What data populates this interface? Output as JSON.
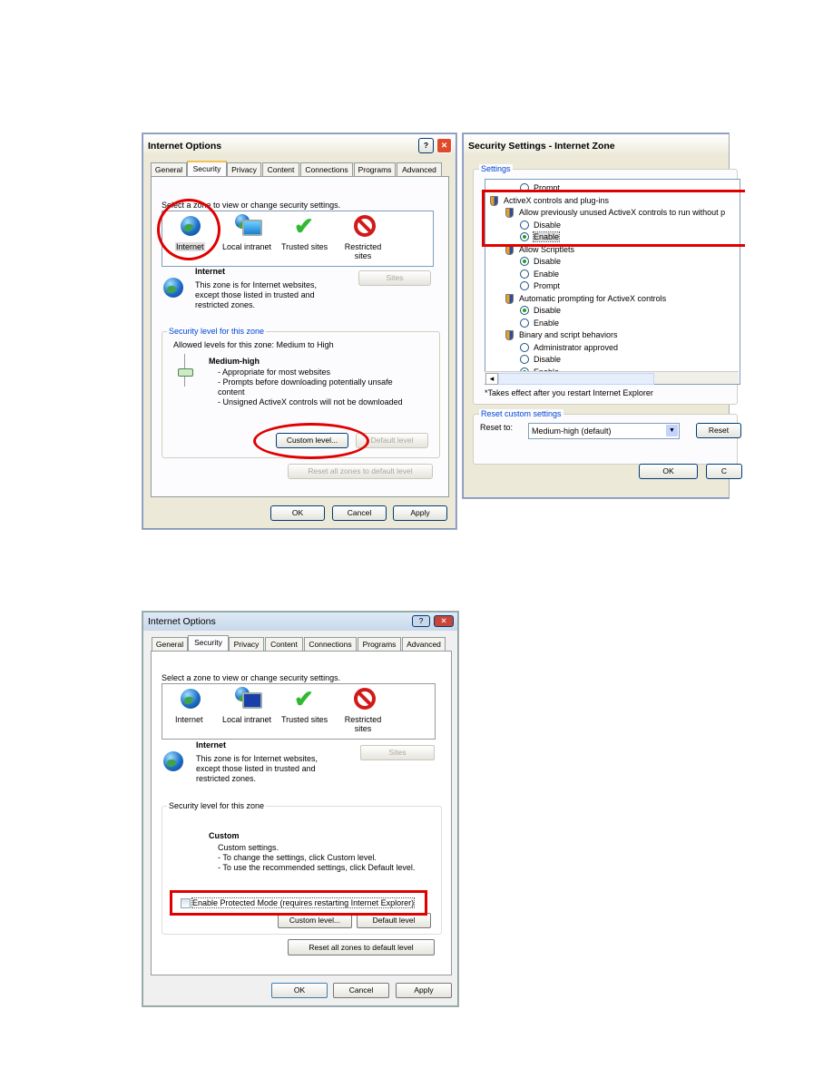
{
  "dialog1": {
    "title": "Internet Options",
    "tabs": [
      "General",
      "Security",
      "Privacy",
      "Content",
      "Connections",
      "Programs",
      "Advanced"
    ],
    "zone_prompt": "Select a zone to view or change security settings.",
    "zones": [
      "Internet",
      "Local intranet",
      "Trusted sites",
      "Restricted sites"
    ],
    "zone_heading": "Internet",
    "zone_desc": [
      "This zone is for Internet websites,",
      "except those listed in trusted and",
      "restricted zones."
    ],
    "sites": "Sites",
    "group_label": "Security level for this zone",
    "allowed": "Allowed levels for this zone: Medium to High",
    "level": "Medium-high",
    "bullets": [
      "- Appropriate for most websites",
      "- Prompts before downloading potentially unsafe",
      "content",
      "- Unsigned ActiveX controls will not be downloaded"
    ],
    "custom_level": "Custom level...",
    "default_level": "Default level",
    "reset_all": "Reset all zones to default level",
    "ok": "OK",
    "cancel": "Cancel",
    "apply": "Apply"
  },
  "dialog2": {
    "title": "Security Settings - Internet Zone",
    "settings_label": "Settings",
    "items": [
      {
        "type": "radio",
        "label": "Prompt",
        "checked": false
      },
      {
        "type": "heading",
        "label": "ActiveX controls and plug-ins"
      },
      {
        "type": "sub",
        "label": "Allow previously unused ActiveX controls to run without p"
      },
      {
        "type": "radio",
        "label": "Disable",
        "checked": false
      },
      {
        "type": "radio",
        "label": "Enable",
        "checked": true
      },
      {
        "type": "sub",
        "label": "Allow Scriptlets"
      },
      {
        "type": "radio",
        "label": "Disable",
        "checked": true
      },
      {
        "type": "radio",
        "label": "Enable",
        "checked": false
      },
      {
        "type": "radio",
        "label": "Prompt",
        "checked": false
      },
      {
        "type": "sub",
        "label": "Automatic prompting for ActiveX controls"
      },
      {
        "type": "radio",
        "label": "Disable",
        "checked": true
      },
      {
        "type": "radio",
        "label": "Enable",
        "checked": false
      },
      {
        "type": "sub",
        "label": "Binary and script behaviors"
      },
      {
        "type": "radio",
        "label": "Administrator approved",
        "checked": false
      },
      {
        "type": "radio",
        "label": "Disable",
        "checked": false
      },
      {
        "type": "radio",
        "label": "Enable",
        "checked": true
      }
    ],
    "note": "*Takes effect after you restart Internet Explorer",
    "reset_group": "Reset custom settings",
    "reset_to": "Reset to:",
    "reset_value": "Medium-high (default)",
    "reset_btn": "Reset",
    "ok": "OK",
    "cancel": "C"
  },
  "dialog3": {
    "title": "Internet Options",
    "tabs": [
      "General",
      "Security",
      "Privacy",
      "Content",
      "Connections",
      "Programs",
      "Advanced"
    ],
    "zone_prompt": "Select a zone to view or change security settings.",
    "zones": [
      "Internet",
      "Local intranet",
      "Trusted sites",
      "Restricted sites"
    ],
    "zone_heading": "Internet",
    "zone_desc": [
      "This zone is for Internet websites,",
      "except those listed in trusted and",
      "restricted zones."
    ],
    "sites": "Sites",
    "group_label": "Security level for this zone",
    "level": "Custom",
    "lines": [
      "Custom settings.",
      "- To change the settings, click Custom level.",
      "- To use the recommended settings, click Default level."
    ],
    "protected_mode": "Enable Protected Mode (requires restarting Internet Explorer)",
    "protected_checked": false,
    "custom_level": "Custom level...",
    "default_level": "Default level",
    "reset_all": "Reset all zones to default level",
    "ok": "OK",
    "cancel": "Cancel",
    "apply": "Apply"
  },
  "colors": {
    "highlight": "#e00000",
    "xp_border": "#7a96df",
    "group_legend": "#0046d5"
  }
}
